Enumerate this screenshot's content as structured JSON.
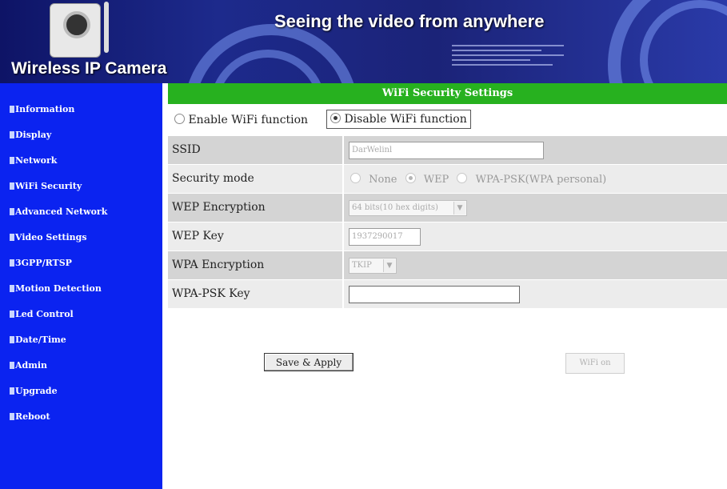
{
  "header": {
    "brand": "Wireless IP Camera",
    "tagline": "Seeing the video from anywhere"
  },
  "sidebar": {
    "items": [
      {
        "label": "Information"
      },
      {
        "label": "Display"
      },
      {
        "label": "Network"
      },
      {
        "label": "WiFi Security"
      },
      {
        "label": "Advanced Network"
      },
      {
        "label": "Video Settings"
      },
      {
        "label": "3GPP/RTSP"
      },
      {
        "label": "Motion Detection"
      },
      {
        "label": "Led Control"
      },
      {
        "label": "Date/Time"
      },
      {
        "label": "Admin"
      },
      {
        "label": "Upgrade"
      },
      {
        "label": "Reboot"
      }
    ]
  },
  "main": {
    "title": "WiFi Security Settings",
    "enable_label": "Enable WiFi function",
    "disable_label": "Disable WiFi function",
    "wifi_enabled": false,
    "ssid": {
      "label": "SSID",
      "value": "DarWelinl"
    },
    "security_mode": {
      "label": "Security mode",
      "options": [
        "None",
        "WEP",
        "WPA-PSK(WPA personal)"
      ],
      "selected": "WEP"
    },
    "wep_encryption": {
      "label": "WEP Encryption",
      "value": "64 bits(10 hex digits)"
    },
    "wep_key": {
      "label": "WEP Key",
      "value": "1937290017"
    },
    "wpa_encryption": {
      "label": "WPA Encryption",
      "value": "TKIP"
    },
    "wpa_psk_key": {
      "label": "WPA-PSK Key",
      "value": ""
    },
    "save_label": "Save & Apply",
    "wifi_on_label": "WiFi on"
  },
  "colors": {
    "sidebar_bg": "#0b23f0",
    "title_bar": "#27b11f",
    "banner": "#1d2a8c"
  }
}
